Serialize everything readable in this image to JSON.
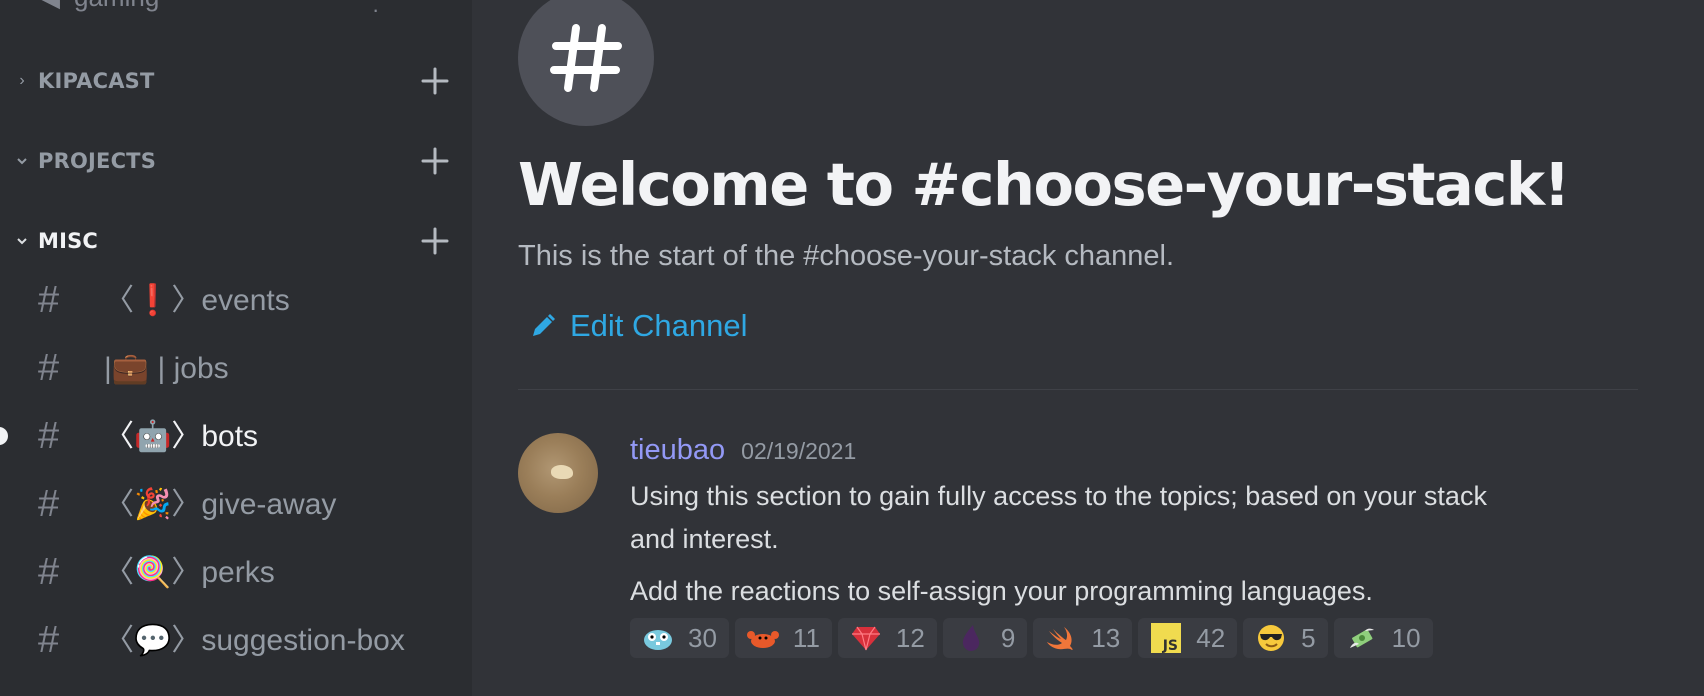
{
  "sidebar": {
    "partial_row_label": "gaming",
    "categories": [
      {
        "label": "KIPACAST",
        "collapsed": true
      },
      {
        "label": "PROJECTS",
        "collapsed": false
      },
      {
        "label": "MISC",
        "collapsed": false,
        "active": true
      }
    ],
    "channels": [
      {
        "label": "〈❗〉events",
        "active": false,
        "unread": false
      },
      {
        "label": "|💼 | jobs",
        "active": false,
        "unread": false
      },
      {
        "label": "〈🤖〉bots",
        "active": true,
        "unread": true
      },
      {
        "label": "〈🎉〉give-away",
        "active": false,
        "unread": false
      },
      {
        "label": "〈🍭〉perks",
        "active": false,
        "unread": false
      },
      {
        "label": "〈💬〉suggestion-box",
        "active": false,
        "unread": false
      }
    ]
  },
  "main": {
    "channel_icon": "#",
    "welcome_title": "Welcome to #choose-your-stack!",
    "welcome_subtitle": "This is the start of the #choose-your-stack channel.",
    "edit_channel_label": "Edit Channel",
    "message": {
      "author": "tieubao",
      "timestamp": "02/19/2021",
      "line1": "Using this section to gain fully access to the topics; based on your stack",
      "line2": "and interest.",
      "line3": "Add the reactions to self-assign your programming languages.",
      "reactions": [
        {
          "icon": "gopher-emoji",
          "count": "30"
        },
        {
          "icon": "crab-emoji",
          "count": "11"
        },
        {
          "icon": "ruby-gem-emoji",
          "count": "12"
        },
        {
          "icon": "elixir-drop-emoji",
          "count": "9"
        },
        {
          "icon": "swift-bird-emoji",
          "count": "13"
        },
        {
          "icon": "js-logo-emoji",
          "count": "42"
        },
        {
          "icon": "sunglasses-face-emoji",
          "count": "5"
        },
        {
          "icon": "money-wings-emoji",
          "count": "10"
        }
      ]
    }
  },
  "colors": {
    "background": "#313338",
    "sidebar": "#2b2d31",
    "link_blue": "#2fa8e3",
    "author_color": "#9399f6"
  }
}
